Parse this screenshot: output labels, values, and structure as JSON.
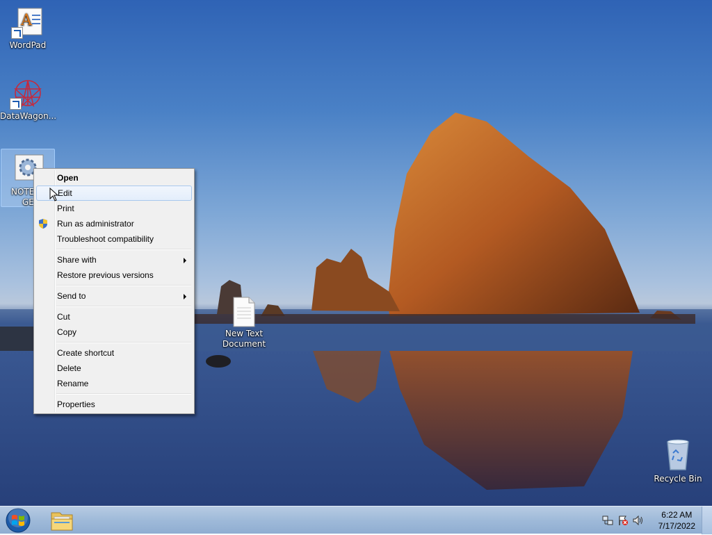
{
  "desktop": {
    "icons": [
      {
        "label": "WordPad"
      },
      {
        "label": "DataWagon..."
      },
      {
        "label_line1": "NOTEPA",
        "label_line2": "GE"
      },
      {
        "label_line1": "New Text",
        "label_line2": "Document"
      },
      {
        "label": "Recycle Bin"
      }
    ]
  },
  "context_menu": {
    "items": {
      "open": "Open",
      "edit": "Edit",
      "print": "Print",
      "run_as_admin": "Run as administrator",
      "troubleshoot": "Troubleshoot compatibility",
      "share_with": "Share with",
      "restore": "Restore previous versions",
      "send_to": "Send to",
      "cut": "Cut",
      "copy": "Copy",
      "create_shortcut": "Create shortcut",
      "delete": "Delete",
      "rename": "Rename",
      "properties": "Properties"
    },
    "highlighted_item": "Edit"
  },
  "taskbar": {
    "clock": {
      "time": "6:22 AM",
      "date": "7/17/2022"
    }
  },
  "colors": {
    "taskbar": "#9fbad9",
    "menu_bg": "#f0f0f0",
    "menu_highlight": "#a8c8ed"
  }
}
